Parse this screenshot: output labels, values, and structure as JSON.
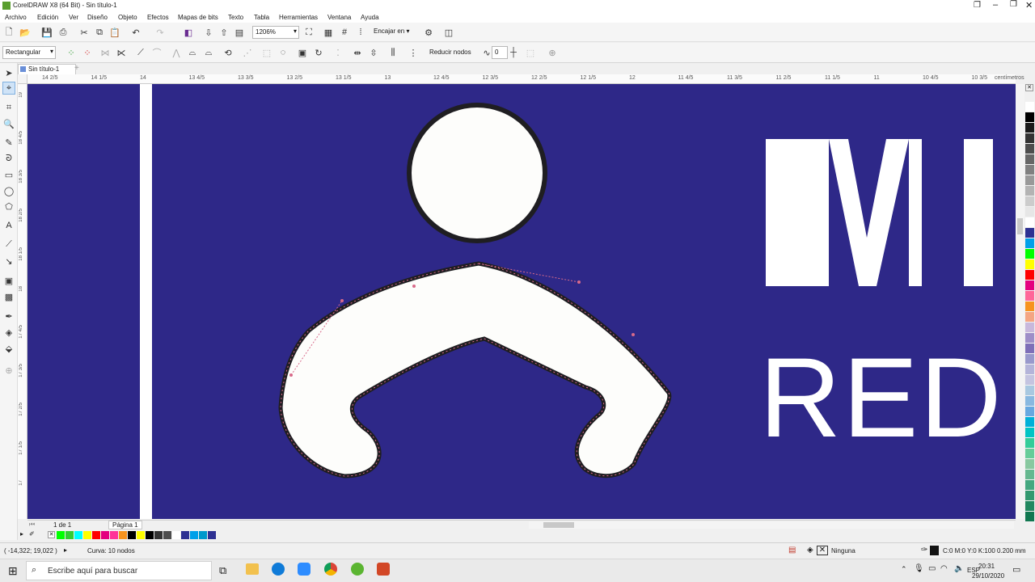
{
  "window": {
    "title": "CorelDRAW X8 (64 Bit) - Sin título-1"
  },
  "menu": [
    "Archivo",
    "Edición",
    "Ver",
    "Diseño",
    "Objeto",
    "Efectos",
    "Mapas de bits",
    "Texto",
    "Tabla",
    "Herramientas",
    "Ventana",
    "Ayuda"
  ],
  "toolbar1": {
    "zoom_value": "1206%",
    "snap_label": "Encajar en"
  },
  "toolbar2": {
    "node_mode_value": "Rectangular",
    "reduce_nodes_label": "Reducir nodos",
    "smoothness_value": "0"
  },
  "tab": {
    "doc_name": "Sin título-1"
  },
  "ruler": {
    "units_label": "centímetros",
    "ticks": [
      "14 2/5",
      "14 1/5",
      "14",
      "13 4/5",
      "13 3/5",
      "13 2/5",
      "13 1/5",
      "13",
      "12 4/5",
      "12 3/5",
      "12 2/5",
      "12 1/5",
      "12",
      "11 4/5",
      "11 3/5",
      "11 2/5",
      "11 1/5",
      "11",
      "10 4/5",
      "10 3/5"
    ],
    "vticks": [
      "19",
      "18 4/5",
      "18 3/5",
      "18 2/5",
      "18 1/5",
      "18",
      "17 4/5",
      "17 3/5",
      "17 2/5",
      "17 1/5",
      "17"
    ]
  },
  "canvas": {
    "heading_partial": "MI",
    "subheading_partial": "RED",
    "bg_color": "#2e2888"
  },
  "pagebar": {
    "page_counter": "1 de 1",
    "page_tab": "Página 1"
  },
  "status": {
    "coords": "( -14,322; 19,022 )",
    "selection_info": "Curva: 10 nodos",
    "fill_label": "Ninguna",
    "outline_info": "C:0 M:0 Y:0 K:100  0.200 mm"
  },
  "taskbar": {
    "search_placeholder": "Escribe aquí para buscar",
    "lang": "ESP",
    "time": "20:31",
    "date": "29/10/2020"
  },
  "palette_colors": [
    "#ffffff",
    "#000000",
    "#1a1a1a",
    "#333333",
    "#4d4d4d",
    "#666666",
    "#808080",
    "#999999",
    "#b3b3b3",
    "#cccccc",
    "#e6e6e6",
    "#ffffff",
    "#2e3192",
    "#00a0e9",
    "#00ff00",
    "#ffff00",
    "#ff0000",
    "#e4007f",
    "#ff6699",
    "#f7931e",
    "#f4a582",
    "#c8b8dc",
    "#9e8ec8",
    "#7e6fb8",
    "#9999cc",
    "#b4b4d9",
    "#c4c4e0",
    "#a8c8e0",
    "#88b8e0",
    "#66a8e0",
    "#00b0d8",
    "#00c4c4",
    "#33cc99",
    "#66cc99",
    "#88c8a0",
    "#66b890",
    "#44a880",
    "#339970",
    "#228860",
    "#117750"
  ],
  "doc_palette": [
    "#00ff00",
    "#33cc33",
    "#00ffff",
    "#ffff00",
    "#ff0000",
    "#e4007f",
    "#ff3399",
    "#f7931e",
    "#000000",
    "#ffff00",
    "#000000",
    "#333333",
    "#4d4d4d",
    "#ffffff",
    "#2e3192",
    "#00a0e9",
    "#0099cc",
    "#2e3192"
  ]
}
